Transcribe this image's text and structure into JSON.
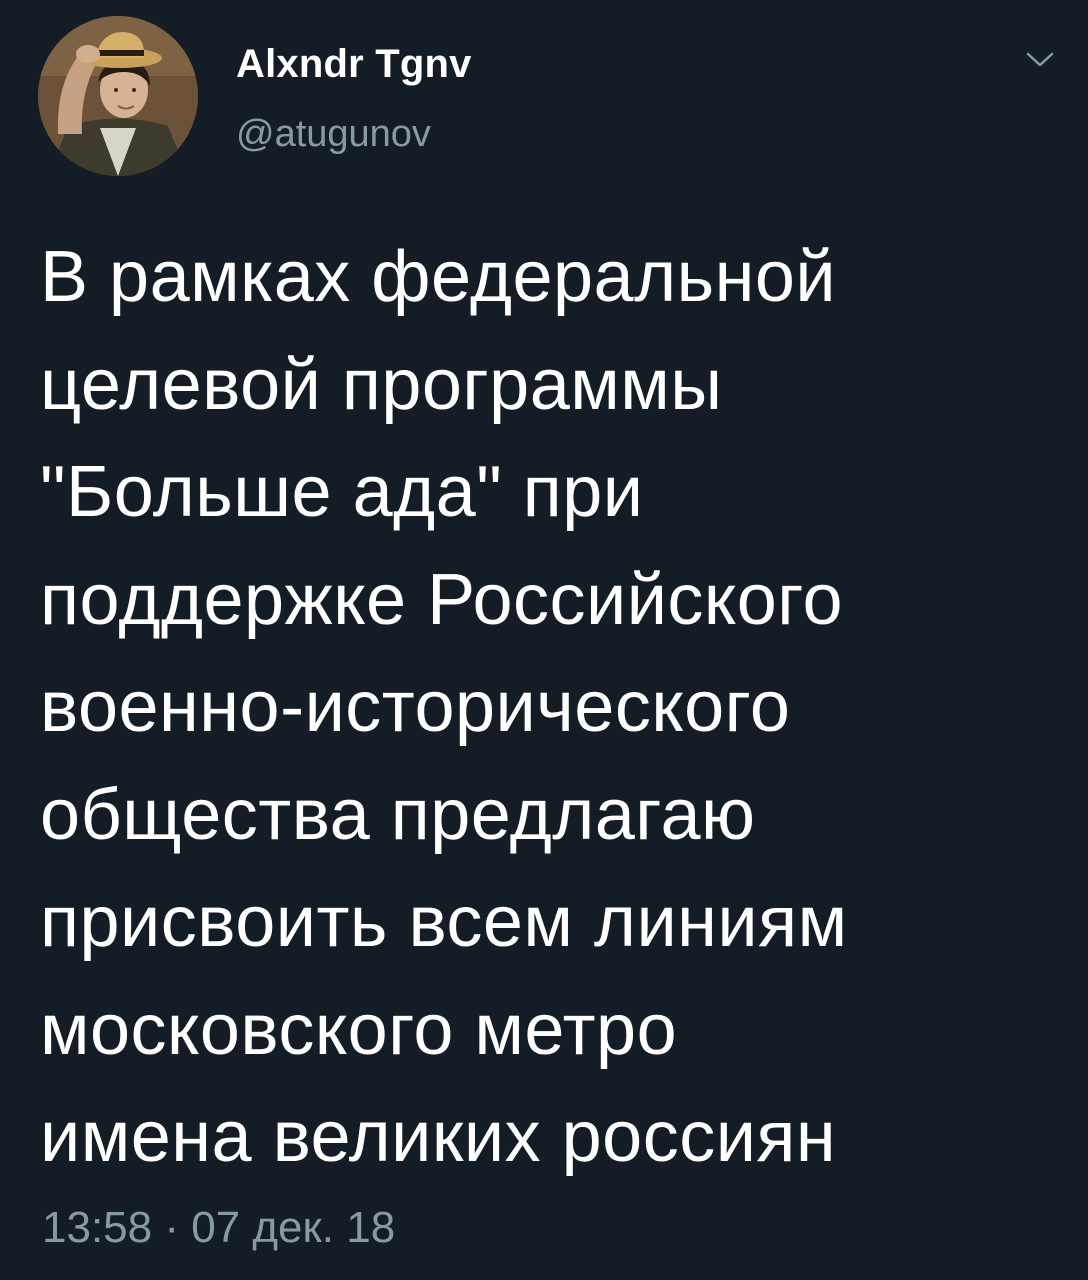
{
  "tweet": {
    "author": {
      "display_name": "Alxndr Tgnv",
      "handle": "@atugunov",
      "avatar_icon": "user-avatar-photo"
    },
    "menu_icon": "chevron-down-icon",
    "text": "В рамках федеральной\nцелевой программы\n\"Больше ада\" при\nподдержке Российского\nвоенно-исторического\nобщества предлагаю\nприсвоить всем линиям\nмосковского метро\nимена великих россиян",
    "timestamp": "13:58 · 07 дек. 18"
  },
  "colors": {
    "background": "#141d26",
    "text": "#ffffff",
    "secondary_text": "#8899a6"
  }
}
